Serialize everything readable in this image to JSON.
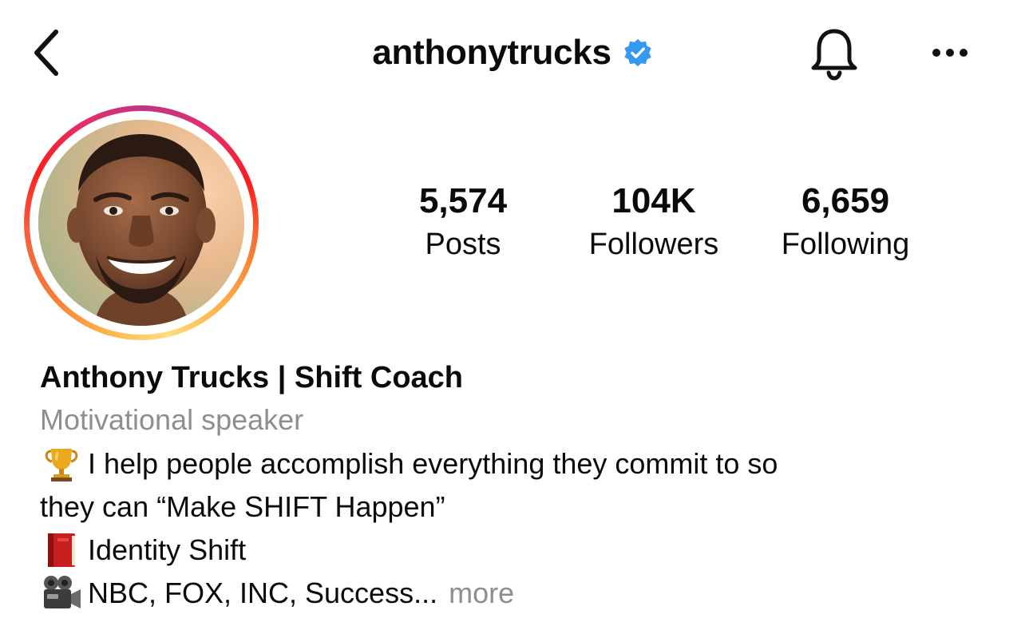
{
  "header": {
    "username": "anthonytrucks",
    "verified": true,
    "verified_color": "#3897f0",
    "back_icon": "chevron-left-icon",
    "bell_icon": "bell-icon",
    "more_icon": "ellipsis-icon"
  },
  "avatar": {
    "has_story_ring": true,
    "ring_colors": [
      "#fcaf45",
      "#f77737",
      "#fd1d1d",
      "#e1306c",
      "#c13584"
    ]
  },
  "stats": {
    "posts": {
      "value": "5,574",
      "label": "Posts"
    },
    "followers": {
      "value": "104K",
      "label": "Followers"
    },
    "following": {
      "value": "6,659",
      "label": "Following"
    }
  },
  "bio": {
    "display_name": "Anthony Trucks | Shift Coach",
    "category": "Motivational speaker",
    "line1_icon": "trophy-icon",
    "line1_text": "I help people accomplish everything they commit to so",
    "line2_text": "they can “Make SHIFT Happen”",
    "line3_icon": "red-book-icon",
    "line3_text": "Identity Shift",
    "line4_icon": "movie-camera-icon",
    "line4_text": "NBC, FOX, INC, Success...",
    "more_label": "more",
    "muted_color": "#8e8e8e"
  }
}
